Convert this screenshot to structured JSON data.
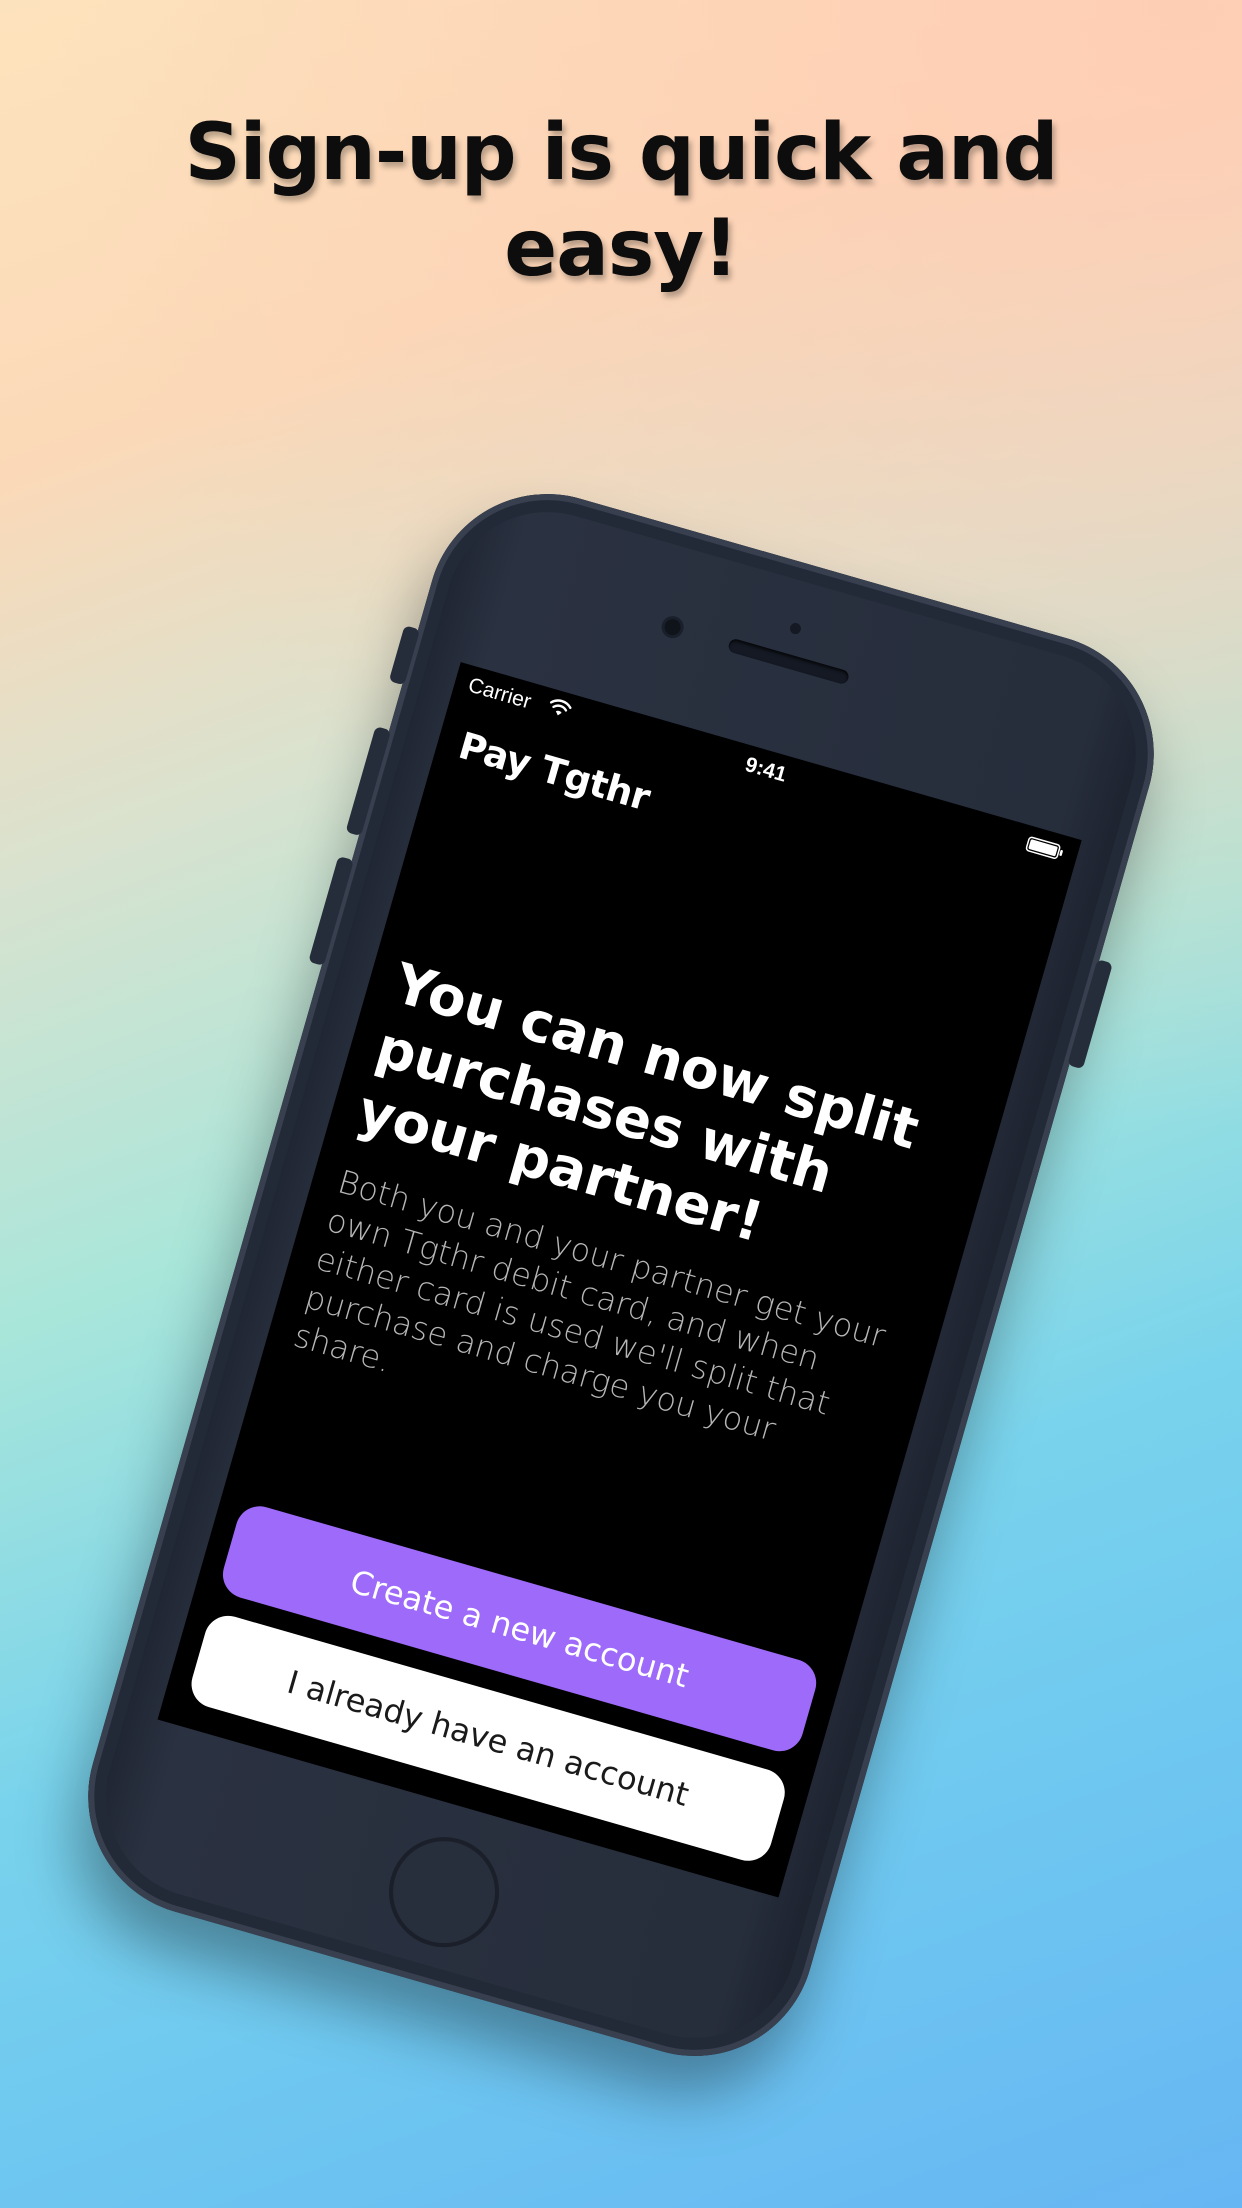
{
  "headline": {
    "line1": "Sign-up is quick and",
    "line2": "easy!"
  },
  "status_bar": {
    "carrier": "Carrier",
    "time": "9:41",
    "wifi_icon": "wifi-icon",
    "battery_icon": "battery-icon"
  },
  "app": {
    "brand": "Pay Tgthr",
    "title": "You can now split purchases with your partner!",
    "description": "Both you and your partner get your own Tgthr debit card, and when either card is used we'll split that purchase and charge you your share.",
    "primary_button": "Create a new account",
    "secondary_button": "I already have an account"
  },
  "colors": {
    "primary_button": "#9e6af9",
    "secondary_button": "#ffffff",
    "screen_background": "#000000",
    "phone_body": "#262d3b"
  }
}
